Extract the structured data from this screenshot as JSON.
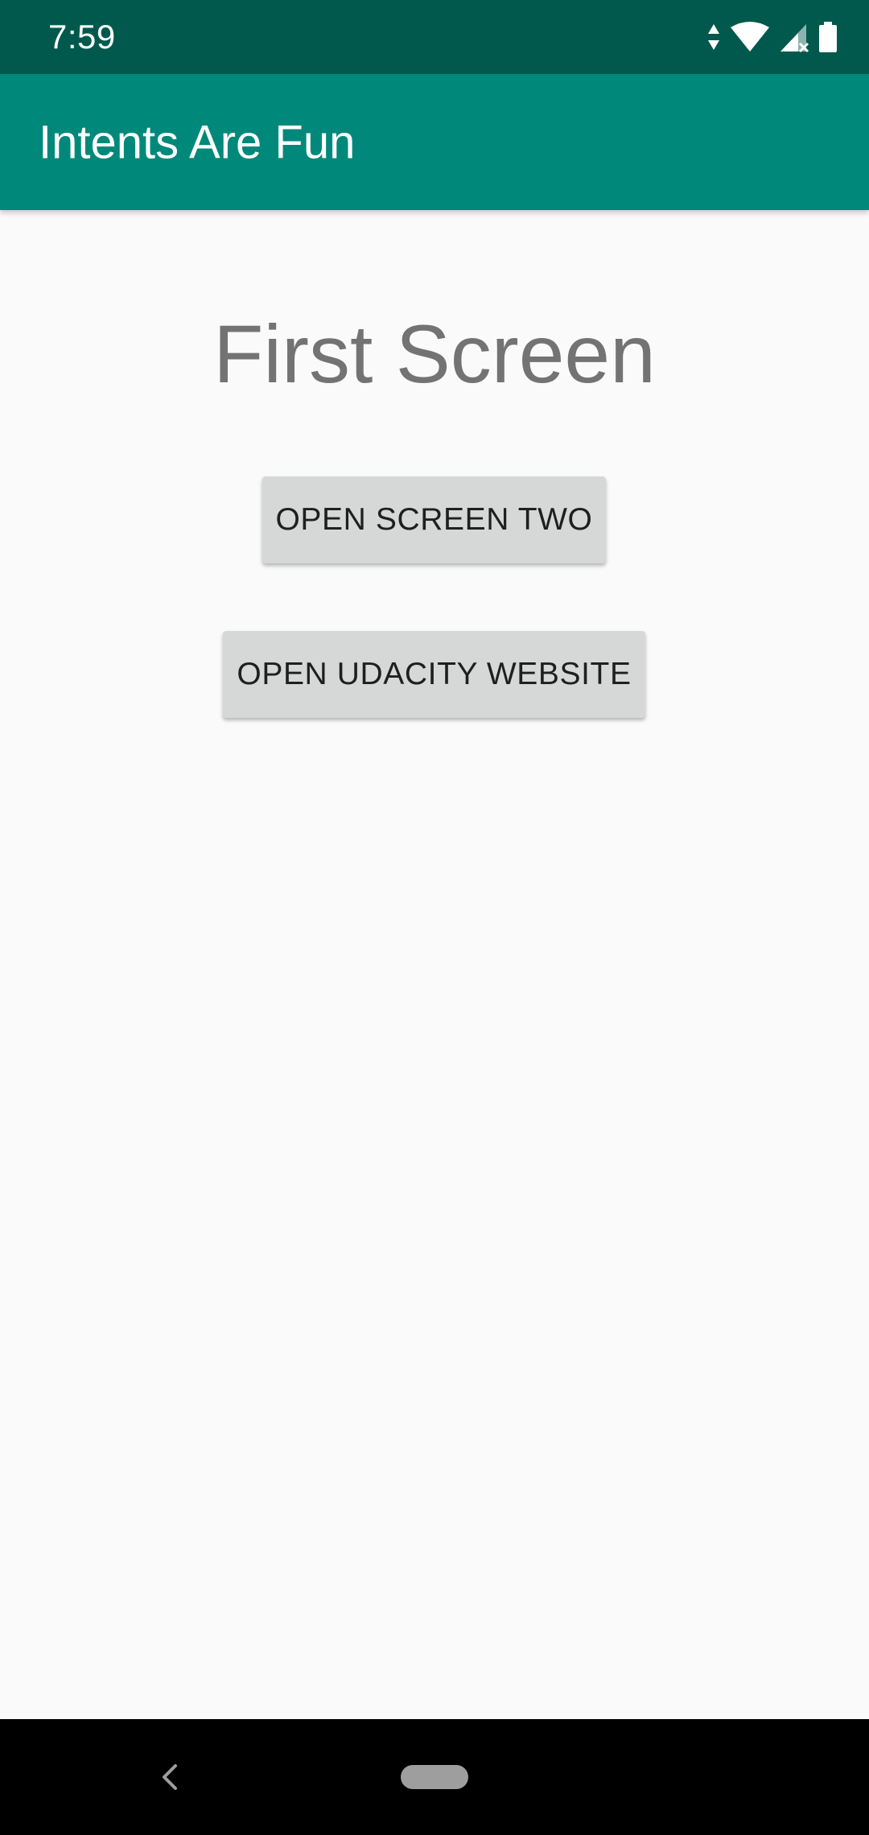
{
  "status_bar": {
    "time": "7:59",
    "icons": [
      "data-transfer-icon",
      "wifi-icon",
      "cell-signal-icon",
      "battery-icon"
    ]
  },
  "app_bar": {
    "title": "Intents Are Fun"
  },
  "main": {
    "heading": "First Screen",
    "buttons": [
      {
        "label": "OPEN SCREEN TWO"
      },
      {
        "label": "OPEN UDACITY WEBSITE"
      }
    ]
  },
  "nav_bar": {
    "icons": [
      "back-icon",
      "home-pill-icon"
    ]
  },
  "colors": {
    "status_bar": "#00594c",
    "app_bar": "#00897b",
    "background": "#fafafa",
    "button": "#d6d7d7",
    "heading_text": "#737373"
  }
}
